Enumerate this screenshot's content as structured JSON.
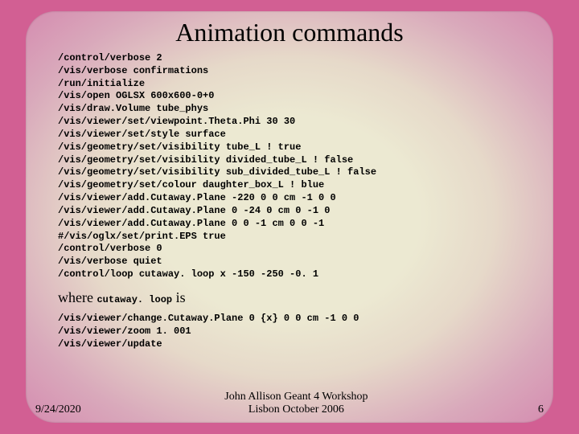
{
  "title": "Animation commands",
  "code1": "/control/verbose 2\n/vis/verbose confirmations\n/run/initialize\n/vis/open OGLSX 600x600-0+0\n/vis/draw.Volume tube_phys\n/vis/viewer/set/viewpoint.Theta.Phi 30 30\n/vis/viewer/set/style surface\n/vis/geometry/set/visibility tube_L ! true\n/vis/geometry/set/visibility divided_tube_L ! false\n/vis/geometry/set/visibility sub_divided_tube_L ! false\n/vis/geometry/set/colour daughter_box_L ! blue\n/vis/viewer/add.Cutaway.Plane -220 0 0 cm -1 0 0\n/vis/viewer/add.Cutaway.Plane 0 -24 0 cm 0 -1 0\n/vis/viewer/add.Cutaway.Plane 0 0 -1 cm 0 0 -1\n#/vis/oglx/set/print.EPS true\n/control/verbose 0\n/vis/verbose quiet\n/control/loop cutaway. loop x -150 -250 -0. 1",
  "where": {
    "prefix": "where ",
    "mono": "cutaway. loop",
    "suffix": " is"
  },
  "code2": "/vis/viewer/change.Cutaway.Plane 0 {x} 0 0 cm -1 0 0\n/vis/viewer/zoom 1. 001\n/vis/viewer/update",
  "footer": {
    "date": "9/24/2020",
    "center_line1": "John Allison  Geant 4 Workshop",
    "center_line2": "Lisbon  October 2006",
    "page": "6"
  }
}
